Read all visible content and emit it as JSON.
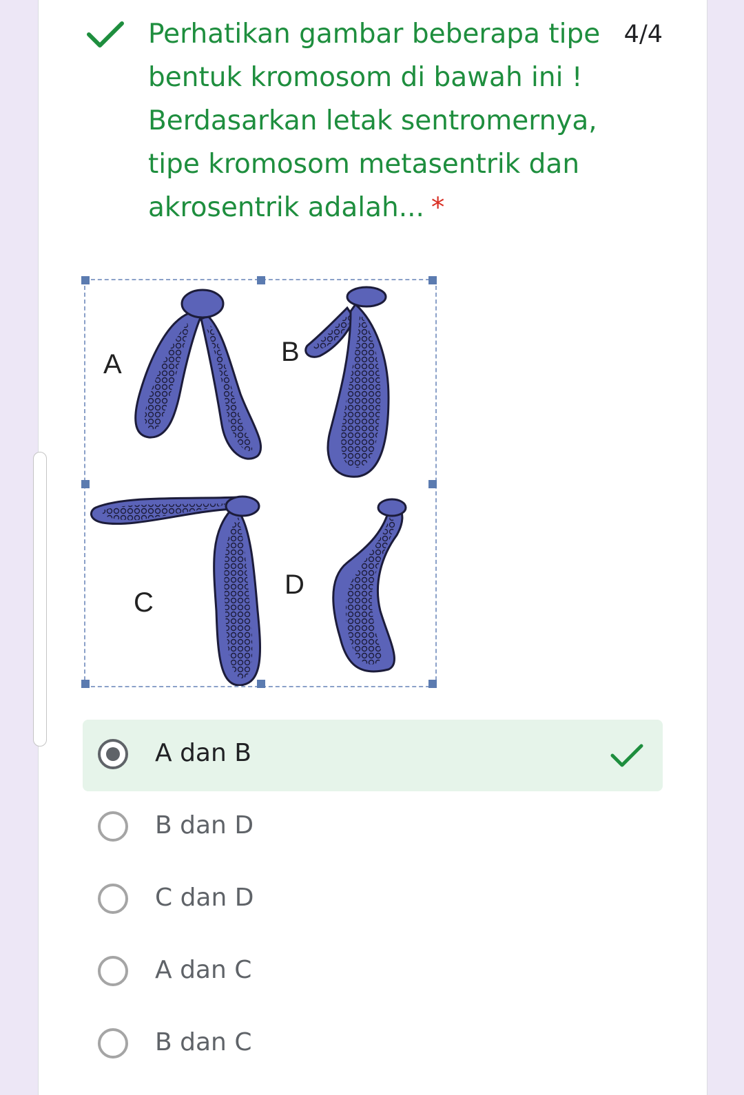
{
  "question": {
    "text": "Perhatikan gambar beberapa tipe bentuk kromosom di bawah ini ! Berdasarkan letak sentromernya, tipe kromosom metasentrik dan akrosentrik adalah...",
    "required_marker": "*",
    "score": "4/4",
    "status_icon": "check-icon",
    "accent_color": "#1e8e3e"
  },
  "figure": {
    "labels": [
      "A",
      "B",
      "C",
      "D"
    ]
  },
  "options": [
    {
      "label": "A dan B",
      "selected": true,
      "correct": true
    },
    {
      "label": "B dan D",
      "selected": false
    },
    {
      "label": "C dan D",
      "selected": false
    },
    {
      "label": "A dan C",
      "selected": false
    },
    {
      "label": "B dan C",
      "selected": false
    }
  ]
}
